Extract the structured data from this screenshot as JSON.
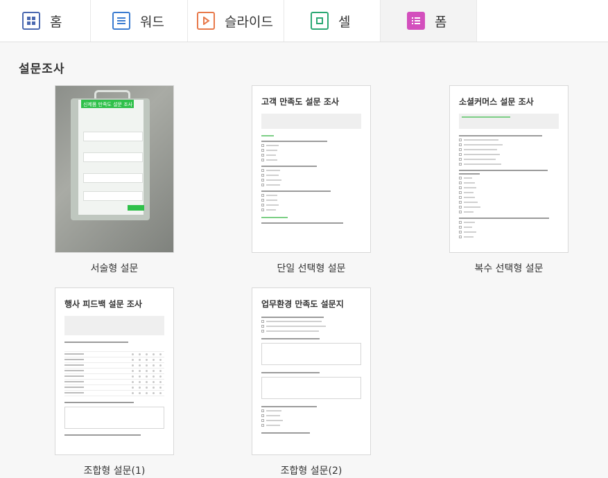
{
  "tabs": [
    {
      "label": "홈",
      "icon": "grid-icon",
      "color": "#4a68b0"
    },
    {
      "label": "워드",
      "icon": "document-lines-icon",
      "color": "#3a7bd0"
    },
    {
      "label": "슬라이드",
      "icon": "play-icon",
      "color": "#e8794a"
    },
    {
      "label": "셀",
      "icon": "square-icon",
      "color": "#2aa873"
    },
    {
      "label": "폼",
      "icon": "list-icon",
      "color": "#d34fbd"
    }
  ],
  "active_tab": "폼",
  "section_title": "설문조사",
  "templates": [
    {
      "caption": "서술형 설문",
      "thumb_title": "신제품 만족도 설문 조사"
    },
    {
      "caption": "단일 선택형 설문",
      "thumb_title": "고객 만족도 설문 조사"
    },
    {
      "caption": "복수 선택형 설문",
      "thumb_title": "소셜커머스 설문 조사"
    },
    {
      "caption": "조합형 설문(1)",
      "thumb_title": "행사 피드백 설문 조사"
    },
    {
      "caption": "조합형 설문(2)",
      "thumb_title": "업무환경 만족도 설문지"
    }
  ]
}
